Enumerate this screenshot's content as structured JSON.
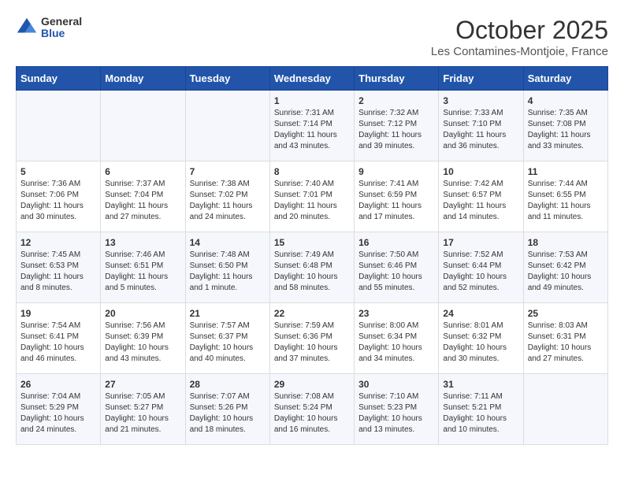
{
  "logo": {
    "general": "General",
    "blue": "Blue"
  },
  "title": "October 2025",
  "subtitle": "Les Contamines-Montjoie, France",
  "days_of_week": [
    "Sunday",
    "Monday",
    "Tuesday",
    "Wednesday",
    "Thursday",
    "Friday",
    "Saturday"
  ],
  "weeks": [
    [
      {
        "day": "",
        "info": ""
      },
      {
        "day": "",
        "info": ""
      },
      {
        "day": "",
        "info": ""
      },
      {
        "day": "1",
        "info": "Sunrise: 7:31 AM\nSunset: 7:14 PM\nDaylight: 11 hours\nand 43 minutes."
      },
      {
        "day": "2",
        "info": "Sunrise: 7:32 AM\nSunset: 7:12 PM\nDaylight: 11 hours\nand 39 minutes."
      },
      {
        "day": "3",
        "info": "Sunrise: 7:33 AM\nSunset: 7:10 PM\nDaylight: 11 hours\nand 36 minutes."
      },
      {
        "day": "4",
        "info": "Sunrise: 7:35 AM\nSunset: 7:08 PM\nDaylight: 11 hours\nand 33 minutes."
      }
    ],
    [
      {
        "day": "5",
        "info": "Sunrise: 7:36 AM\nSunset: 7:06 PM\nDaylight: 11 hours\nand 30 minutes."
      },
      {
        "day": "6",
        "info": "Sunrise: 7:37 AM\nSunset: 7:04 PM\nDaylight: 11 hours\nand 27 minutes."
      },
      {
        "day": "7",
        "info": "Sunrise: 7:38 AM\nSunset: 7:02 PM\nDaylight: 11 hours\nand 24 minutes."
      },
      {
        "day": "8",
        "info": "Sunrise: 7:40 AM\nSunset: 7:01 PM\nDaylight: 11 hours\nand 20 minutes."
      },
      {
        "day": "9",
        "info": "Sunrise: 7:41 AM\nSunset: 6:59 PM\nDaylight: 11 hours\nand 17 minutes."
      },
      {
        "day": "10",
        "info": "Sunrise: 7:42 AM\nSunset: 6:57 PM\nDaylight: 11 hours\nand 14 minutes."
      },
      {
        "day": "11",
        "info": "Sunrise: 7:44 AM\nSunset: 6:55 PM\nDaylight: 11 hours\nand 11 minutes."
      }
    ],
    [
      {
        "day": "12",
        "info": "Sunrise: 7:45 AM\nSunset: 6:53 PM\nDaylight: 11 hours\nand 8 minutes."
      },
      {
        "day": "13",
        "info": "Sunrise: 7:46 AM\nSunset: 6:51 PM\nDaylight: 11 hours\nand 5 minutes."
      },
      {
        "day": "14",
        "info": "Sunrise: 7:48 AM\nSunset: 6:50 PM\nDaylight: 11 hours\nand 1 minute."
      },
      {
        "day": "15",
        "info": "Sunrise: 7:49 AM\nSunset: 6:48 PM\nDaylight: 10 hours\nand 58 minutes."
      },
      {
        "day": "16",
        "info": "Sunrise: 7:50 AM\nSunset: 6:46 PM\nDaylight: 10 hours\nand 55 minutes."
      },
      {
        "day": "17",
        "info": "Sunrise: 7:52 AM\nSunset: 6:44 PM\nDaylight: 10 hours\nand 52 minutes."
      },
      {
        "day": "18",
        "info": "Sunrise: 7:53 AM\nSunset: 6:42 PM\nDaylight: 10 hours\nand 49 minutes."
      }
    ],
    [
      {
        "day": "19",
        "info": "Sunrise: 7:54 AM\nSunset: 6:41 PM\nDaylight: 10 hours\nand 46 minutes."
      },
      {
        "day": "20",
        "info": "Sunrise: 7:56 AM\nSunset: 6:39 PM\nDaylight: 10 hours\nand 43 minutes."
      },
      {
        "day": "21",
        "info": "Sunrise: 7:57 AM\nSunset: 6:37 PM\nDaylight: 10 hours\nand 40 minutes."
      },
      {
        "day": "22",
        "info": "Sunrise: 7:59 AM\nSunset: 6:36 PM\nDaylight: 10 hours\nand 37 minutes."
      },
      {
        "day": "23",
        "info": "Sunrise: 8:00 AM\nSunset: 6:34 PM\nDaylight: 10 hours\nand 34 minutes."
      },
      {
        "day": "24",
        "info": "Sunrise: 8:01 AM\nSunset: 6:32 PM\nDaylight: 10 hours\nand 30 minutes."
      },
      {
        "day": "25",
        "info": "Sunrise: 8:03 AM\nSunset: 6:31 PM\nDaylight: 10 hours\nand 27 minutes."
      }
    ],
    [
      {
        "day": "26",
        "info": "Sunrise: 7:04 AM\nSunset: 5:29 PM\nDaylight: 10 hours\nand 24 minutes."
      },
      {
        "day": "27",
        "info": "Sunrise: 7:05 AM\nSunset: 5:27 PM\nDaylight: 10 hours\nand 21 minutes."
      },
      {
        "day": "28",
        "info": "Sunrise: 7:07 AM\nSunset: 5:26 PM\nDaylight: 10 hours\nand 18 minutes."
      },
      {
        "day": "29",
        "info": "Sunrise: 7:08 AM\nSunset: 5:24 PM\nDaylight: 10 hours\nand 16 minutes."
      },
      {
        "day": "30",
        "info": "Sunrise: 7:10 AM\nSunset: 5:23 PM\nDaylight: 10 hours\nand 13 minutes."
      },
      {
        "day": "31",
        "info": "Sunrise: 7:11 AM\nSunset: 5:21 PM\nDaylight: 10 hours\nand 10 minutes."
      },
      {
        "day": "",
        "info": ""
      }
    ]
  ]
}
